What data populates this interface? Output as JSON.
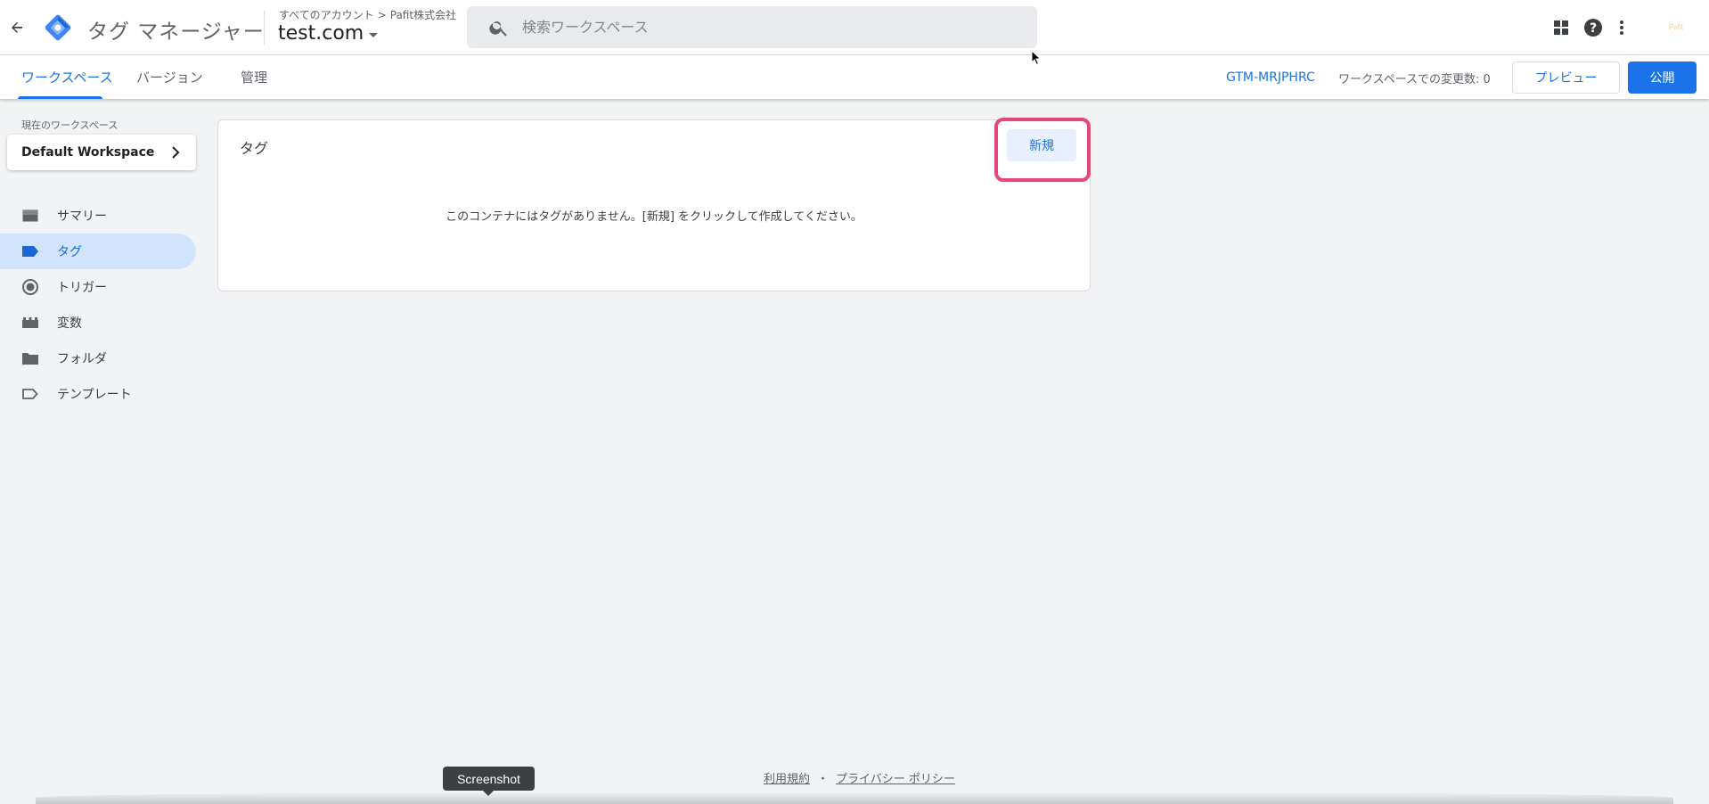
{
  "header": {
    "app_title": "タグ マネージャー",
    "breadcrumb_account": "すべてのアカウント",
    "breadcrumb_separator": ">",
    "breadcrumb_company": "Pafit株式会社",
    "container_name": "test.com",
    "search_placeholder": "検索ワークスペース",
    "account_logo_text": "Pafit",
    "icons": [
      "back-arrow-icon",
      "gtm-logo-icon",
      "search-icon",
      "apps-grid-icon",
      "help-icon",
      "more-vert-icon"
    ]
  },
  "subnav": {
    "tabs": [
      {
        "label": "ワークスペース",
        "active": true
      },
      {
        "label": "バージョン",
        "active": false
      },
      {
        "label": "管理",
        "active": false
      }
    ],
    "container_id": "GTM-MRJPHRC",
    "changes_label": "ワークスペースでの変更数: 0",
    "preview_label": "プレビュー",
    "publish_label": "公開"
  },
  "sidebar": {
    "workspace_label": "現在のワークスペース",
    "workspace_name": "Default Workspace",
    "items": [
      {
        "label": "サマリー",
        "icon": "summary-icon",
        "active": false
      },
      {
        "label": "タグ",
        "icon": "tag-icon",
        "active": true
      },
      {
        "label": "トリガー",
        "icon": "trigger-icon",
        "active": false
      },
      {
        "label": "変数",
        "icon": "variables-icon",
        "active": false
      },
      {
        "label": "フォルダ",
        "icon": "folder-icon",
        "active": false
      },
      {
        "label": "テンプレート",
        "icon": "template-icon",
        "active": false
      }
    ]
  },
  "main": {
    "card_title": "タグ",
    "new_button": "新規",
    "empty_message": "このコンテナにはタグがありません。[新規] をクリックして作成してください。"
  },
  "footer": {
    "terms": "利用規約",
    "separator": "・",
    "privacy": "プライバシー ポリシー"
  },
  "tooltip": {
    "text": "Screenshot"
  },
  "colors": {
    "accent": "#1a73e8",
    "highlight": "#e8457a",
    "background": "#f1f3f4",
    "active_nav": "#d2e3fc"
  }
}
